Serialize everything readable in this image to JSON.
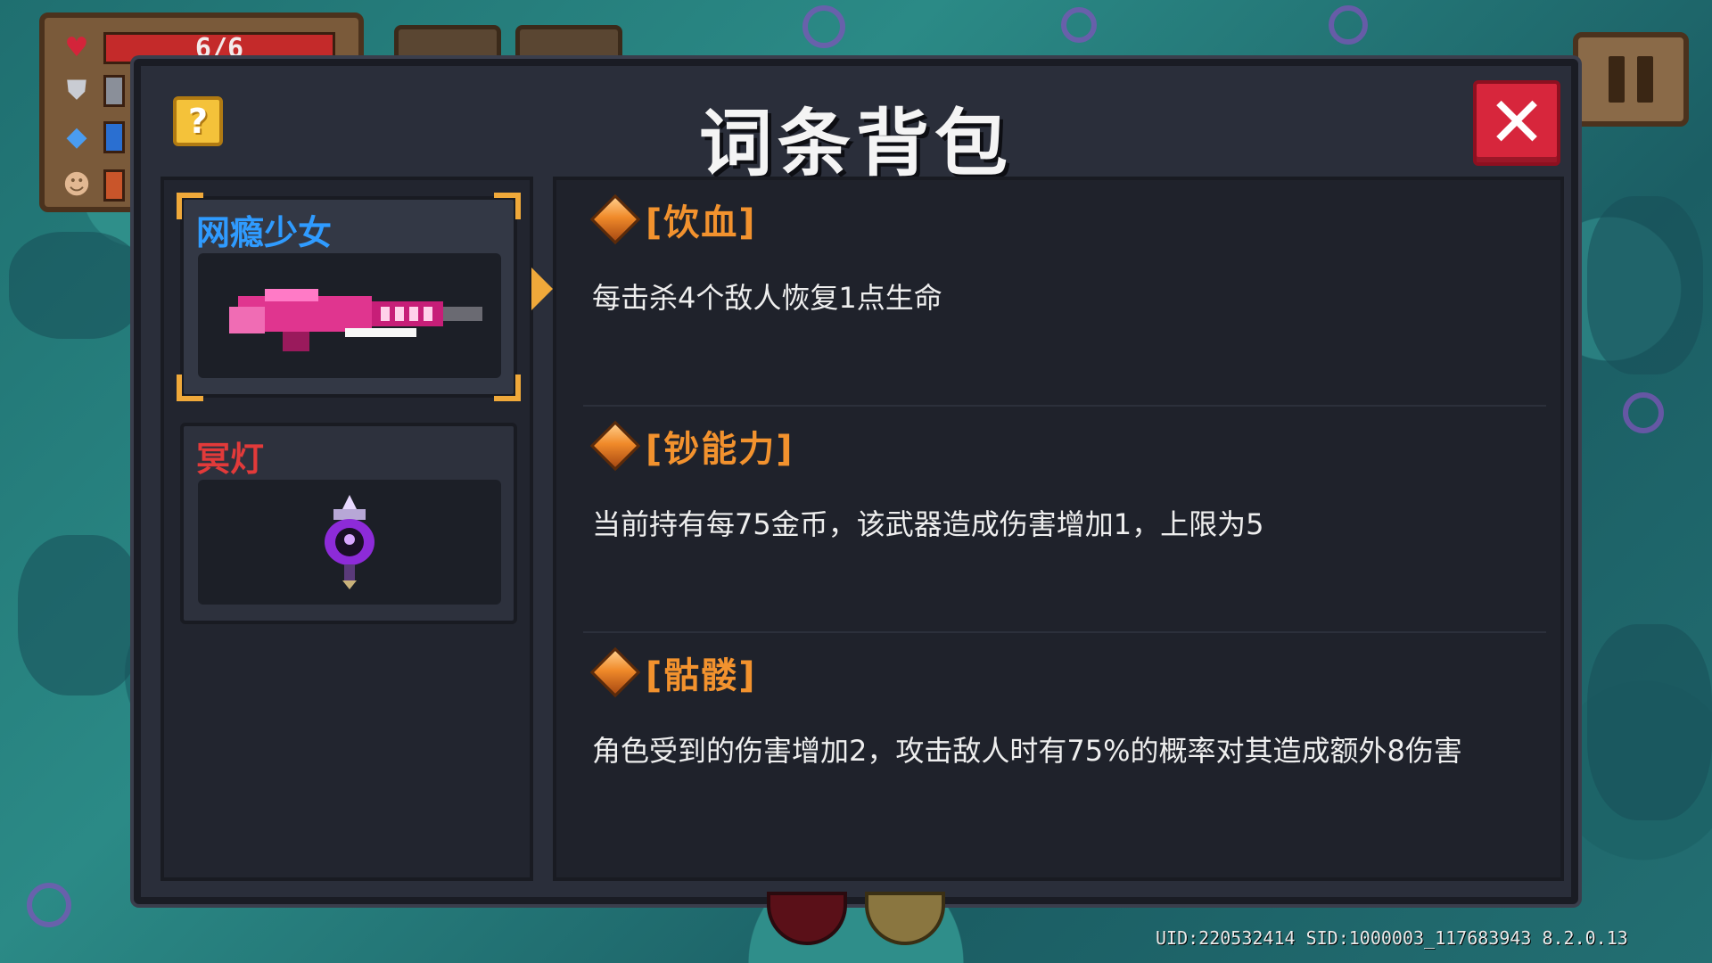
{
  "hud": {
    "hp_text": "6/6",
    "icons": [
      "heart-icon",
      "shield-icon",
      "energy-diamond-icon",
      "character-portrait-icon"
    ],
    "hp_color": "#c42a2a",
    "armor_color": "#8a8f99",
    "energy_color": "#2a6fd1"
  },
  "panel": {
    "title": "词条背包",
    "help_label": "?",
    "close_label": "✕"
  },
  "weapons": [
    {
      "name": "网瘾少女",
      "name_color": "#2f9bff",
      "selected": true,
      "icon": "pink-gun-icon"
    },
    {
      "name": "冥灯",
      "name_color": "#e23a3a",
      "selected": false,
      "icon": "purple-lantern-icon"
    }
  ],
  "affixes": [
    {
      "name": "[饮血]",
      "desc": "每击杀4个敌人恢复1点生命"
    },
    {
      "name": "[钞能力]",
      "desc": "当前持有每75金币，该武器造成伤害增加1，上限为5"
    },
    {
      "name": "[骷髅]",
      "desc": "角色受到的伤害增加2，攻击敌人时有75%的概率对其造成额外8伤害"
    }
  ],
  "build_info": "UID:220532414 SID:1000003_117683943 8.2.0.13",
  "colors": {
    "affix_name": "#f2922e",
    "selection_corner": "#f0a93a",
    "close_button": "#d7263c",
    "help_button": "#f4c23a"
  }
}
